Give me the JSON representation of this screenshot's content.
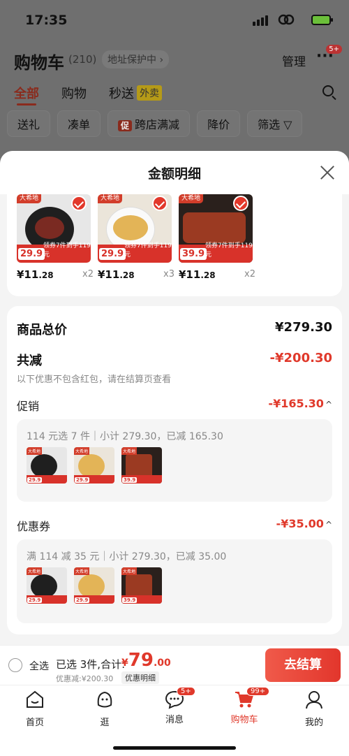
{
  "status_bar": {
    "time": "17:35"
  },
  "background_page": {
    "title": "购物车",
    "count": "(210)",
    "address": "地址保护中 ›",
    "manage": "管理",
    "more_badge": "5+",
    "tabs": [
      "全部",
      "购物",
      "秒送"
    ],
    "takeout_tag": "外卖",
    "chips": [
      "送礼",
      "凑单",
      "跨店满减",
      "降价",
      "筛选 ▽"
    ],
    "promo_tag": "促"
  },
  "sheet": {
    "title": "金额明细",
    "products": [
      {
        "brand": "大希地",
        "price_tag": "29.9",
        "coupon": "领券7件到手119元",
        "unit_price": "¥11",
        "unit_dec": ".28",
        "qty": "x2",
        "color": "#3b2a25",
        "plate": "#7a2a22"
      },
      {
        "brand": "大希地",
        "price_tag": "29.9",
        "coupon": "领券7件到手119元",
        "unit_price": "¥11",
        "unit_dec": ".28",
        "qty": "x3",
        "color": "#e9e0d2",
        "plate": "#e5b95e"
      },
      {
        "brand": "大希地",
        "price_tag": "39.9",
        "coupon": "领券7件到手119元",
        "unit_price": "¥11",
        "unit_dec": ".28",
        "qty": "x2",
        "color": "#3a2a22",
        "plate": "#9b3a22"
      }
    ],
    "goods_total_label": "商品总价",
    "goods_total_value": "¥279.30",
    "discount_label": "共减",
    "discount_value": "-¥200.30",
    "discount_note": "以下优惠不包含红包，请在结算页查看",
    "promo_label": "促销",
    "promo_value": "-¥165.30",
    "promo_desc": "114 元选 7 件｜小计 279.30，已减 165.30",
    "mini_prices": [
      "29.9",
      "29.9",
      "39.9"
    ],
    "coupon_label": "优惠券",
    "coupon_value": "-¥35.00",
    "coupon_desc": "满 114 减 35 元｜小计 279.30，已减 35.00"
  },
  "checkout": {
    "select_all": "全选",
    "selected_text": "已选 3件,合计:",
    "total_currency": "¥",
    "total_int": "79",
    "total_dec": ".00",
    "saved_text": "优惠减:¥200.30",
    "detail_label": "优惠明细",
    "pay_label": "去结算"
  },
  "tabbar": {
    "items": [
      {
        "label": "首页"
      },
      {
        "label": "逛"
      },
      {
        "label": "消息",
        "badge": "5+"
      },
      {
        "label": "购物车",
        "badge": "99+"
      },
      {
        "label": "我的"
      }
    ]
  },
  "colors": {
    "accent": "#e0392b",
    "dim_bg": "#6f6f6f"
  }
}
